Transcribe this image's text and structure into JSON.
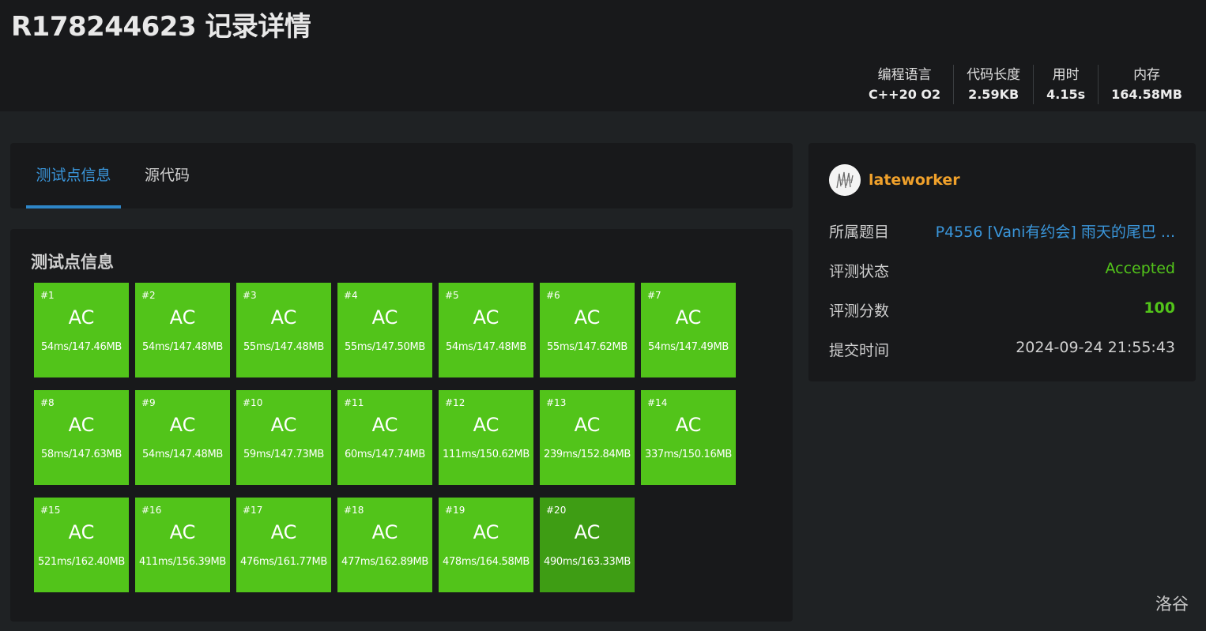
{
  "page": {
    "title": "R178244623 记录详情"
  },
  "stats": [
    {
      "label": "编程语言",
      "value": "C++20 O2"
    },
    {
      "label": "代码长度",
      "value": "2.59KB"
    },
    {
      "label": "用时",
      "value": "4.15s"
    },
    {
      "label": "内存",
      "value": "164.58MB"
    }
  ],
  "tabs": [
    {
      "label": "测试点信息",
      "active": true
    },
    {
      "label": "源代码",
      "active": false
    }
  ],
  "tests_section": {
    "title": "测试点信息",
    "cases": [
      {
        "id": "#1",
        "status": "AC",
        "detail": "54ms/147.46MB"
      },
      {
        "id": "#2",
        "status": "AC",
        "detail": "54ms/147.48MB"
      },
      {
        "id": "#3",
        "status": "AC",
        "detail": "55ms/147.48MB"
      },
      {
        "id": "#4",
        "status": "AC",
        "detail": "55ms/147.50MB"
      },
      {
        "id": "#5",
        "status": "AC",
        "detail": "54ms/147.48MB"
      },
      {
        "id": "#6",
        "status": "AC",
        "detail": "55ms/147.62MB"
      },
      {
        "id": "#7",
        "status": "AC",
        "detail": "54ms/147.49MB"
      },
      {
        "id": "#8",
        "status": "AC",
        "detail": "58ms/147.63MB"
      },
      {
        "id": "#9",
        "status": "AC",
        "detail": "54ms/147.48MB"
      },
      {
        "id": "#10",
        "status": "AC",
        "detail": "59ms/147.73MB"
      },
      {
        "id": "#11",
        "status": "AC",
        "detail": "60ms/147.74MB"
      },
      {
        "id": "#12",
        "status": "AC",
        "detail": "111ms/150.62MB"
      },
      {
        "id": "#13",
        "status": "AC",
        "detail": "239ms/152.84MB"
      },
      {
        "id": "#14",
        "status": "AC",
        "detail": "337ms/150.16MB"
      },
      {
        "id": "#15",
        "status": "AC",
        "detail": "521ms/162.40MB"
      },
      {
        "id": "#16",
        "status": "AC",
        "detail": "411ms/156.39MB"
      },
      {
        "id": "#17",
        "status": "AC",
        "detail": "476ms/161.77MB"
      },
      {
        "id": "#18",
        "status": "AC",
        "detail": "477ms/162.89MB"
      },
      {
        "id": "#19",
        "status": "AC",
        "detail": "478ms/164.58MB"
      },
      {
        "id": "#20",
        "status": "AC",
        "detail": "490ms/163.33MB",
        "highlighted": true
      }
    ]
  },
  "info": {
    "username": "lateworker",
    "avatar_icon": "user-avatar-icon",
    "rows": {
      "problem": {
        "label": "所属题目",
        "value": "P4556 [Vani有约会] 雨天的尾巴 ..."
      },
      "status": {
        "label": "评测状态",
        "value": "Accepted"
      },
      "score": {
        "label": "评测分数",
        "value": "100"
      },
      "submit_time": {
        "label": "提交时间",
        "value": "2024-09-24 21:55:43"
      }
    }
  },
  "watermark": "洛谷",
  "colors": {
    "accent": "#3a96db",
    "ac_green": "#52c41a",
    "ac_green_selected": "#3e9d14",
    "username": "#f0a12b",
    "card_bg": "#18191b",
    "page_bg": "#1f2224"
  }
}
